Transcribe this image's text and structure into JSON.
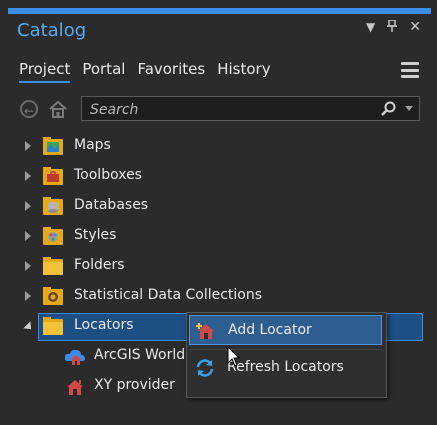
{
  "panel": {
    "title": "Catalog",
    "controls": [
      "dropdown-icon",
      "pin-icon",
      "close-icon"
    ],
    "accent_color": "#3a8ee6"
  },
  "tabs": [
    {
      "label": "Project",
      "active": true
    },
    {
      "label": "Portal",
      "active": false
    },
    {
      "label": "Favorites",
      "active": false
    },
    {
      "label": "History",
      "active": false
    }
  ],
  "search": {
    "placeholder": "Search",
    "value": ""
  },
  "tree": [
    {
      "label": "Maps",
      "icon": "maps-folder-icon",
      "expanded": false
    },
    {
      "label": "Toolboxes",
      "icon": "toolbox-folder-icon",
      "expanded": false
    },
    {
      "label": "Databases",
      "icon": "database-folder-icon",
      "expanded": false
    },
    {
      "label": "Styles",
      "icon": "styles-folder-icon",
      "expanded": false
    },
    {
      "label": "Folders",
      "icon": "folder-icon",
      "expanded": false
    },
    {
      "label": "Statistical Data Collections",
      "icon": "statistical-data-icon",
      "expanded": false
    },
    {
      "label": "Locators",
      "icon": "locators-folder-icon",
      "expanded": true,
      "selected": true,
      "children": [
        {
          "label": "ArcGIS World G",
          "icon": "world-locator-icon"
        },
        {
          "label": "XY provider",
          "icon": "xy-locator-icon"
        }
      ]
    }
  ],
  "context_menu": {
    "items": [
      {
        "label": "Add Locator",
        "icon": "add-locator-icon",
        "hover": true
      },
      {
        "label": "Refresh Locators",
        "icon": "refresh-icon",
        "hover": false
      }
    ]
  }
}
